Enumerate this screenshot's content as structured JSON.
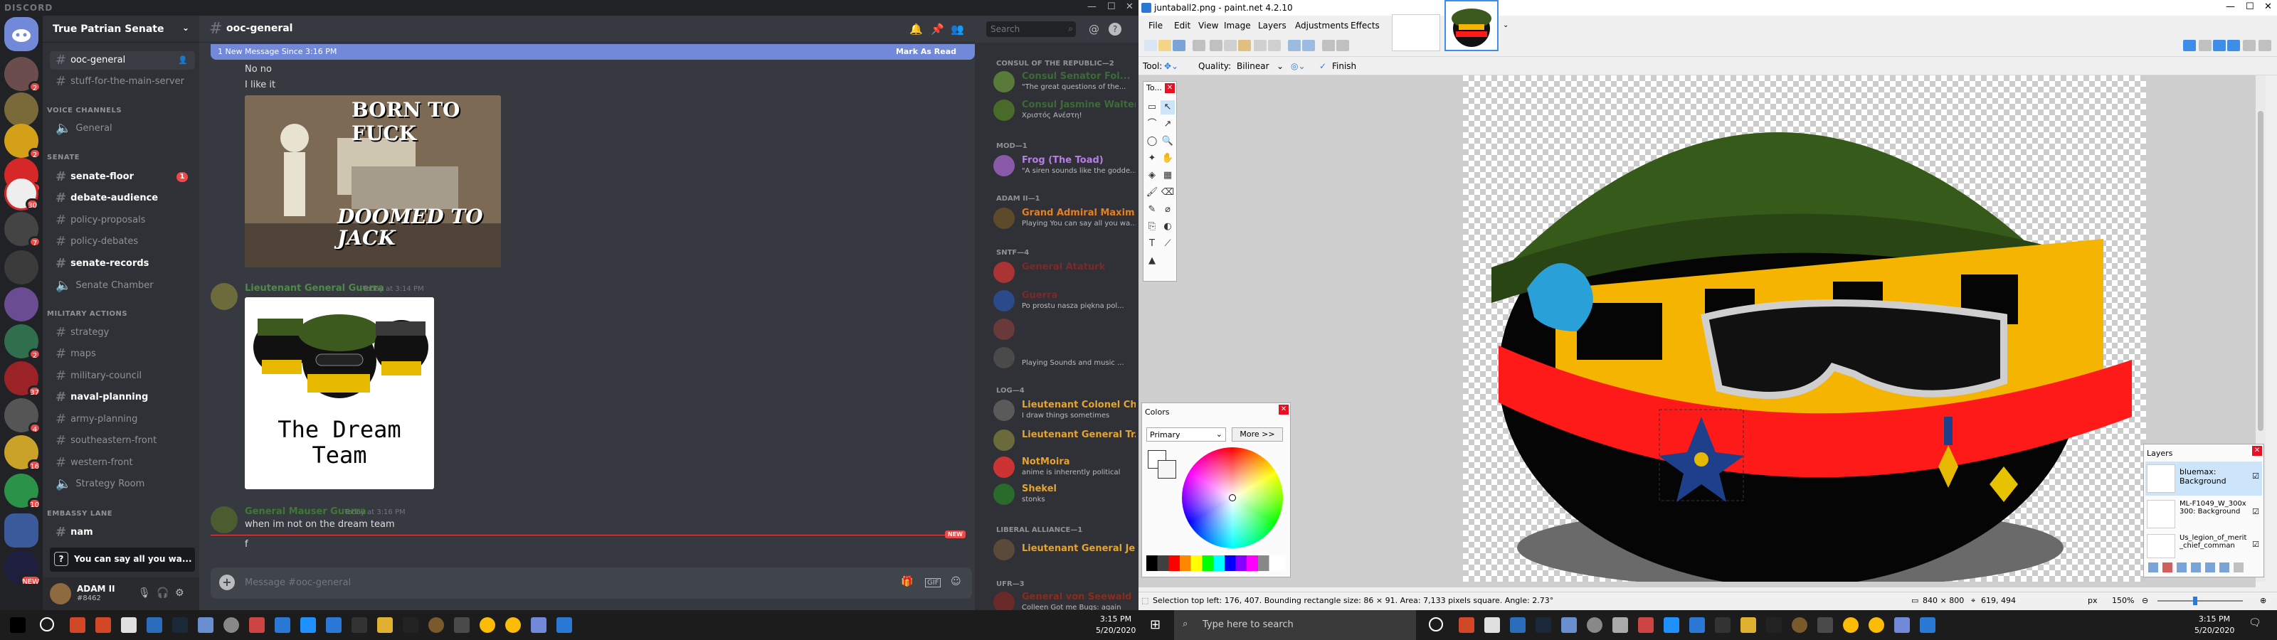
{
  "discord": {
    "brand": "DISCORD",
    "server_name": "True Patrian Senate",
    "channel_title": "ooc-general",
    "search_placeholder": "Search",
    "guild_badges": [
      "2",
      "2",
      "2",
      "30",
      "7",
      "2",
      "37",
      "4",
      "16",
      "10",
      "NEW"
    ],
    "channels": {
      "top": [
        {
          "label": "ooc-general",
          "state": "active"
        },
        {
          "label": "stuff-for-the-main-server",
          "state": "normal"
        }
      ],
      "cat_voice": "VOICE CHANNELS",
      "voice": [
        {
          "label": "General"
        }
      ],
      "cat_senate": "SENATE",
      "senate": [
        {
          "label": "senate-floor",
          "state": "unread",
          "badge": "1"
        },
        {
          "label": "debate-audience",
          "state": "unread"
        },
        {
          "label": "policy-proposals",
          "state": "normal"
        },
        {
          "label": "policy-debates",
          "state": "normal"
        },
        {
          "label": "senate-records",
          "state": "unread"
        },
        {
          "label": "Senate Chamber",
          "state": "normal"
        }
      ],
      "cat_military": "MILITARY ACTIONS",
      "military": [
        {
          "label": "strategy",
          "state": "normal"
        },
        {
          "label": "maps",
          "state": "normal"
        },
        {
          "label": "military-council",
          "state": "normal"
        },
        {
          "label": "naval-planning",
          "state": "unread"
        },
        {
          "label": "army-planning",
          "state": "normal"
        },
        {
          "label": "southeastern-front",
          "state": "normal"
        },
        {
          "label": "western-front",
          "state": "normal"
        },
        {
          "label": "Strategy Room",
          "state": "normal"
        }
      ],
      "cat_embassy": "EMBASSY LANE",
      "embassy": [
        {
          "label": "nam",
          "state": "unread"
        }
      ]
    },
    "popup_text": "You can say all you wa...",
    "user": {
      "name": "ADAM II",
      "tag": "#8462"
    },
    "new_bar": {
      "text": "1 New Message Since 3:16 PM",
      "action": "Mark As Read"
    },
    "messages": {
      "m1": "No no",
      "m2": "I like it",
      "meme_text_top": "BORN TO FUCK",
      "meme_text_bottom": "DOOMED TO JACK",
      "author2": "Lieutenant General Guerra",
      "ts2": "Today at 3:14 PM",
      "dream_team_caption": "The Dream Team",
      "author3": "General Mauser Guerra",
      "ts3": "Today at 3:16 PM",
      "m3": "when im not on the dream team",
      "m4": "f",
      "new_label": "NEW"
    },
    "composer_placeholder": "Message #ooc-general",
    "members": {
      "cat1": "CONSUL OF THE REPUBLIC—2",
      "cat2": "MOD—1",
      "cat3": "ADAM II—1",
      "cat4": "SNTF—4",
      "cat5": "LOG—4",
      "cat6": "LIBERAL ALLIANCE—1",
      "cat7": "UFR—3",
      "rows": [
        {
          "name": "Consul Senator Fol...",
          "status": "\"The great questions of the...",
          "color": "#4f8a48"
        },
        {
          "name": "Consul Jasmine Walter",
          "status": "Χριστός Ανέστη!",
          "color": "#4f8a48"
        },
        {
          "name": "Frog (The Toad)",
          "status": "\"A siren sounds like the godde...",
          "color": "#b87de6"
        },
        {
          "name": "Grand Admiral Maxim...",
          "status": "Playing You can say all you wa...",
          "color": "#e67e22"
        },
        {
          "name": "General Ataturk",
          "status": "",
          "color": "#8b3a3a"
        },
        {
          "name": "Guerra",
          "status": "Po prostu nasza piękna pol...",
          "color": "#8b3a3a"
        },
        {
          "name": "",
          "status": "",
          "color": "#8b3a3a"
        },
        {
          "name": "",
          "status": "Playing Sounds and music ...",
          "color": "#8b3a3a"
        },
        {
          "name": "Lieutenant Colonel Ch...",
          "status": "I draw things sometimes",
          "color": "#e6a32e"
        },
        {
          "name": "Lieutenant General Tr...",
          "status": "",
          "color": "#e6a32e"
        },
        {
          "name": "NotMoira",
          "status": "anime is inherently political",
          "color": "#e6a32e"
        },
        {
          "name": "Shekel",
          "status": "stonks",
          "color": "#e6a32e"
        },
        {
          "name": "Lieutenant General Jeb",
          "status": "",
          "color": "#e6a32e"
        },
        {
          "name": "General von Seewald",
          "status": "Colleen Got me Bugs: again",
          "color": "#c0392b"
        }
      ]
    }
  },
  "paint": {
    "title": "juntaball2.png - paint.net 4.2.10",
    "menu": [
      "File",
      "Edit",
      "View",
      "Image",
      "Layers",
      "Adjustments",
      "Effects"
    ],
    "tool_label": "Tool:",
    "quality_label": "Quality:",
    "quality_value": "Bilinear",
    "finish_label": "Finish",
    "tools_panel_title": "To...",
    "colors_panel": {
      "title": "Colors",
      "mode": "Primary",
      "more": "More >>"
    },
    "layers_panel": {
      "title": "Layers",
      "items": [
        {
          "name": "bluemax: Background"
        },
        {
          "name": "ML-F1049_W_300x300: Background"
        },
        {
          "name": "Us_legion_of_merit_chief_comman"
        }
      ]
    },
    "status": {
      "selection": "Selection top left: 176, 407. Bounding rectangle size: 86 × 91. Area: 7,133 pixels square. Angle: 2.73°",
      "dims": "840 × 800",
      "cursor": "619, 494",
      "unit": "px",
      "zoom": "150%"
    }
  },
  "taskbar": {
    "search_placeholder": "Type here to search",
    "left_time": "3:15 PM",
    "left_date": "5/20/2020",
    "right_time": "3:15 PM",
    "right_date": "5/20/2020"
  },
  "colors": {
    "discord_bg": "#36393f",
    "blurple": "#7289da",
    "unread_red": "#f04747",
    "paint_red_stripe": "#ff1a1a",
    "paint_yellow": "#f5b400"
  }
}
